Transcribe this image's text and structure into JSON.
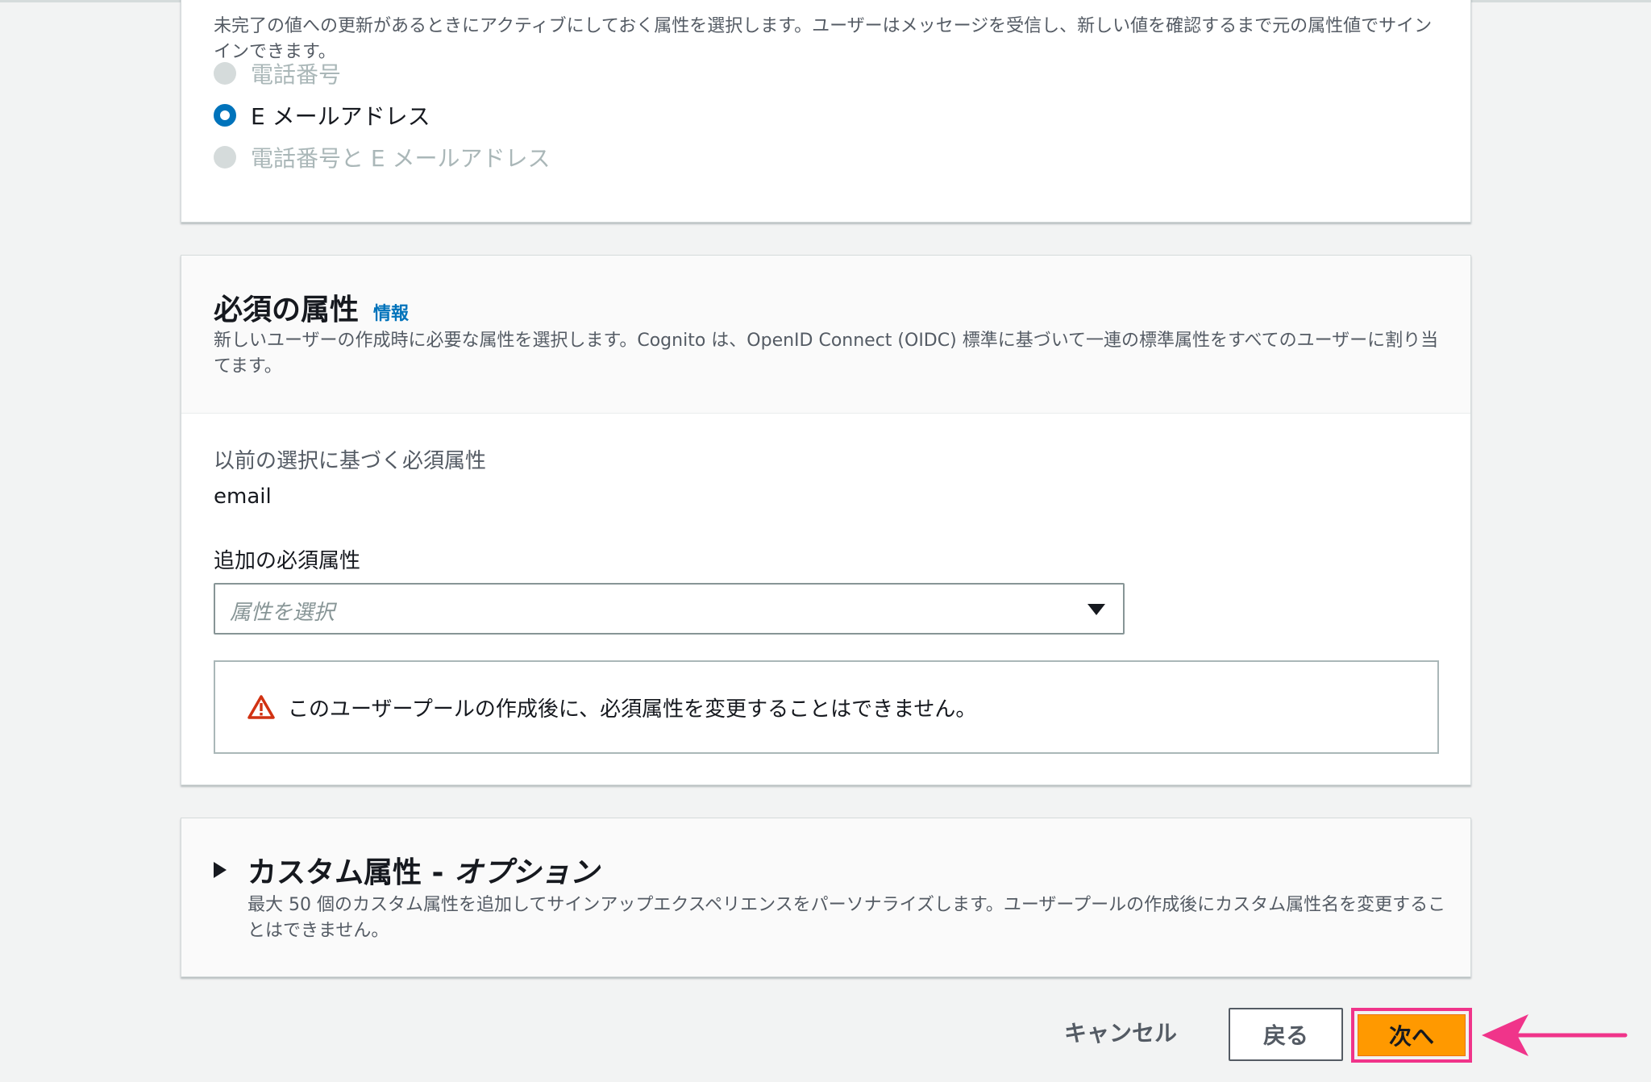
{
  "verification": {
    "description": "未完了の値への更新があるときにアクティブにしておく属性を選択します。ユーザーはメッセージを受信し、新しい値を確認するまで元の属性値でサインインできます。",
    "options": [
      {
        "label": "電話番号",
        "state": "disabled"
      },
      {
        "label": "E メールアドレス",
        "state": "checked"
      },
      {
        "label": "電話番号と E メールアドレス",
        "state": "disabled"
      }
    ]
  },
  "required_attributes": {
    "title": "必須の属性",
    "info_link": "情報",
    "description": "新しいユーザーの作成時に必要な属性を選択します。Cognito は、OpenID Connect (OIDC) 標準に基づいて一連の標準属性をすべてのユーザーに割り当てます。",
    "previous_label": "以前の選択に基づく必須属性",
    "previous_value": "email",
    "additional_label": "追加の必須属性",
    "select_placeholder": "属性を選択",
    "alert_text": "このユーザープールの作成後に、必須属性を変更することはできません。"
  },
  "custom_attributes": {
    "title": "カスタム属性 - ",
    "title_suffix": "オプション",
    "description": "最大 50 個のカスタム属性を追加してサインアップエクスペリエンスをパーソナライズします。ユーザープールの作成後にカスタム属性名を変更することはできません。"
  },
  "footer": {
    "cancel_label": "キャンセル",
    "back_label": "戻る",
    "next_label": "次へ"
  },
  "colors": {
    "primary_button": "#ff9900",
    "highlight": "#f0348a",
    "link": "#0073bb"
  }
}
